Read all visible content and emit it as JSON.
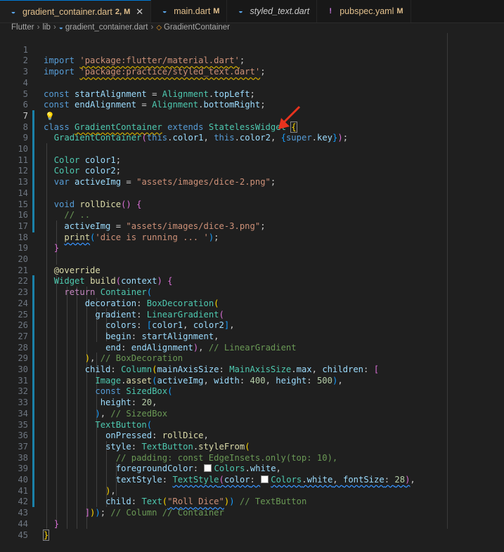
{
  "tabs": [
    {
      "icon": "dart-icon",
      "label": "gradient_container.dart",
      "badge": "2, M",
      "active": true,
      "close": "✕",
      "style": "mod"
    },
    {
      "icon": "dart-icon",
      "label": "main.dart",
      "badge": "M",
      "active": false,
      "style": "plain"
    },
    {
      "icon": "dart-icon",
      "label": "styled_text.dart",
      "badge": "",
      "active": false,
      "style": "ital"
    },
    {
      "icon": "yaml-warning-icon",
      "label": "pubspec.yaml",
      "badge": "M",
      "active": false,
      "style": "plain"
    }
  ],
  "breadcrumb": [
    "Flutter",
    "lib",
    "gradient_container.dart",
    "GradientContainer"
  ],
  "line_numbers": [
    "1",
    "2",
    "3",
    "4",
    "5",
    "6",
    "7",
    "8",
    "9",
    "10",
    "11",
    "12",
    "13",
    "14",
    "15",
    "16",
    "17",
    "18",
    "19",
    "20",
    "21",
    "22",
    "23",
    "24",
    "25",
    "26",
    "27",
    "28",
    "29",
    "30",
    "31",
    "32",
    "33",
    "34",
    "35",
    "36",
    "37",
    "38",
    "39",
    "40",
    "41",
    "42",
    "43",
    "44",
    "45"
  ],
  "code": {
    "import_kw": "import",
    "l1_str": "'package:flutter/material.dart'",
    "l2_str": "'package:practice/styled_text.dart'",
    "semi": ";",
    "const_kw": "const",
    "l4_var": "startAlignment",
    "eq": " = ",
    "alignment": "Alignment",
    "l4_prop": "topLeft",
    "l5_var": "endAlignment",
    "l5_prop": "bottomRight",
    "class_kw": "class",
    "class_name": "GradientContainer",
    "extends_kw": "extends",
    "base_class": "StatelessWidget",
    "brace_open": "{",
    "brace_close": "}",
    "ctor_name": "GradientContainer",
    "this_kw": "this",
    "color1": "color1",
    "color2": "color2",
    "super_kw": "super",
    "key": "key",
    "color_type": "Color",
    "var_kw": "var",
    "active_img": "activeImg",
    "img2": "\"assets/images/dice-2.png\"",
    "void_kw": "void",
    "roll_dice": "rollDice",
    "comment_dots": "// ..",
    "img3": "\"assets/images/dice-3.png\"",
    "print_fn": "print",
    "print_str": "'dice is running ... '",
    "override": "@override",
    "widget_type": "Widget",
    "build_fn": "build",
    "context": "context",
    "return_kw": "return",
    "container": "Container",
    "decoration": "decoration",
    "box_decoration": "BoxDecoration",
    "gradient": "gradient",
    "linear_gradient": "LinearGradient",
    "colors": "colors",
    "begin": "begin",
    "end": "end",
    "cm_linear": "// LinearGradient",
    "cm_boxdec": "// BoxDecoration",
    "child": "child",
    "column": "Column",
    "main_axis_size": "mainAxisSize",
    "main_axis_size_type": "MainAxisSize",
    "max": "max",
    "children": "children",
    "image": "Image",
    "asset": "asset",
    "width": "width",
    "height": "height",
    "n400": "400",
    "n500": "500",
    "sized_box": "SizedBox",
    "n20": "20",
    "cm_sizedbox": "// SizedBox",
    "text_button": "TextButton",
    "on_pressed": "onPressed",
    "style": "style",
    "style_from": "styleFrom",
    "cm_padding": "// padding: const EdgeInsets.only(top: 10),",
    "foreground_color": "foregroundColor",
    "colors_cls": "Colors",
    "white": "white",
    "text_style": "textStyle",
    "text_style_type": "TextStyle",
    "color": "color",
    "font_size": "fontSize",
    "n28": "28",
    "text": "Text",
    "roll_dice_str": "\"Roll Dice\"",
    "cm_textbutton": "// TextButton",
    "cm_column_container": "// Column // Container"
  },
  "colors": {
    "accent": "#0078d4",
    "keyword": "#569cd6",
    "type": "#4ec9b0",
    "string": "#ce9178",
    "arrow": "#e8331e"
  }
}
